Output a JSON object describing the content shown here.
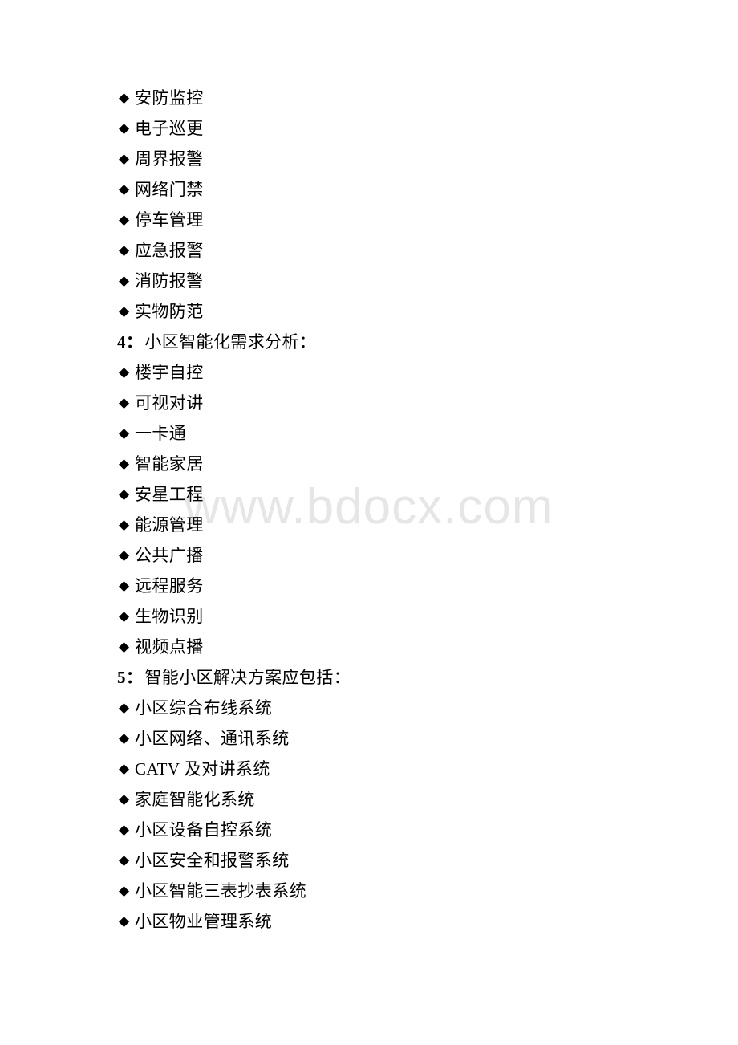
{
  "page": {
    "background_color": "#ffffff",
    "text_color": "#000000",
    "bullet_glyph": "◆"
  },
  "watermark": {
    "text": "www.bdocx.com",
    "color": "#e6e6e6"
  },
  "blocks": [
    {
      "kind": "bullet",
      "text": "安防监控"
    },
    {
      "kind": "bullet",
      "text": "电子巡更"
    },
    {
      "kind": "bullet",
      "text": "周界报警"
    },
    {
      "kind": "bullet",
      "text": "网络门禁"
    },
    {
      "kind": "bullet",
      "text": "停车管理"
    },
    {
      "kind": "bullet",
      "text": "应急报警"
    },
    {
      "kind": "bullet",
      "text": "消防报警"
    },
    {
      "kind": "bullet",
      "text": "实物防范"
    },
    {
      "kind": "heading",
      "number": "4：",
      "text": "小区智能化需求分析："
    },
    {
      "kind": "bullet",
      "text": "楼宇自控"
    },
    {
      "kind": "bullet",
      "text": "可视对讲"
    },
    {
      "kind": "bullet",
      "text": "一卡通"
    },
    {
      "kind": "bullet",
      "text": "智能家居"
    },
    {
      "kind": "bullet",
      "text": "安星工程"
    },
    {
      "kind": "bullet",
      "text": "能源管理"
    },
    {
      "kind": "bullet",
      "text": "公共广播"
    },
    {
      "kind": "bullet",
      "text": "远程服务"
    },
    {
      "kind": "bullet",
      "text": "生物识别"
    },
    {
      "kind": "bullet",
      "text": "视频点播"
    },
    {
      "kind": "heading",
      "number": "5：",
      "text": "智能小区解决方案应包括："
    },
    {
      "kind": "bullet",
      "text": "小区综合布线系统"
    },
    {
      "kind": "bullet",
      "text": "小区网络、通讯系统"
    },
    {
      "kind": "bullet",
      "text": "CATV 及对讲系统"
    },
    {
      "kind": "bullet",
      "text": "家庭智能化系统"
    },
    {
      "kind": "bullet",
      "text": "小区设备自控系统"
    },
    {
      "kind": "bullet",
      "text": "小区安全和报警系统"
    },
    {
      "kind": "bullet",
      "text": "小区智能三表抄表系统"
    },
    {
      "kind": "bullet",
      "text": "小区物业管理系统"
    }
  ]
}
